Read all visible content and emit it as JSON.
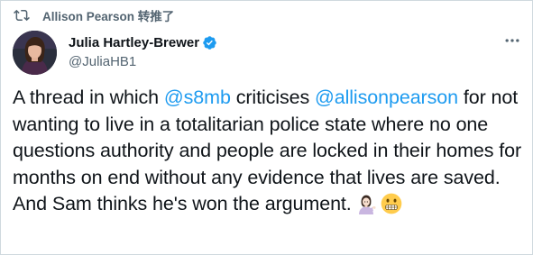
{
  "retweet": {
    "icon": "retweet-icon",
    "label": "Allison Pearson 转推了"
  },
  "author": {
    "display_name": "Julia Hartley-Brewer",
    "handle": "@JuliaHB1",
    "verified": true,
    "verified_icon": "verified-badge-icon",
    "verified_color": "#1d9bf0"
  },
  "more_icon": "more-options-icon",
  "tweet": {
    "text_1": "A thread in which ",
    "mention_1": "@s8mb",
    "text_2": " criticises ",
    "mention_2": "@allisonpearson",
    "text_3": " for not wanting to live in a totalitarian police state where no one questions authority and people are locked in their homes for months on end without any evidence that lives are saved. And Sam thinks he's won the argument.",
    "emojis": [
      "woman-tipping-hand-emoji",
      "grimacing-face-emoji"
    ]
  },
  "colors": {
    "text": "#0f1419",
    "secondary": "#536471",
    "link": "#1d9bf0",
    "border": "#cfd9de"
  }
}
